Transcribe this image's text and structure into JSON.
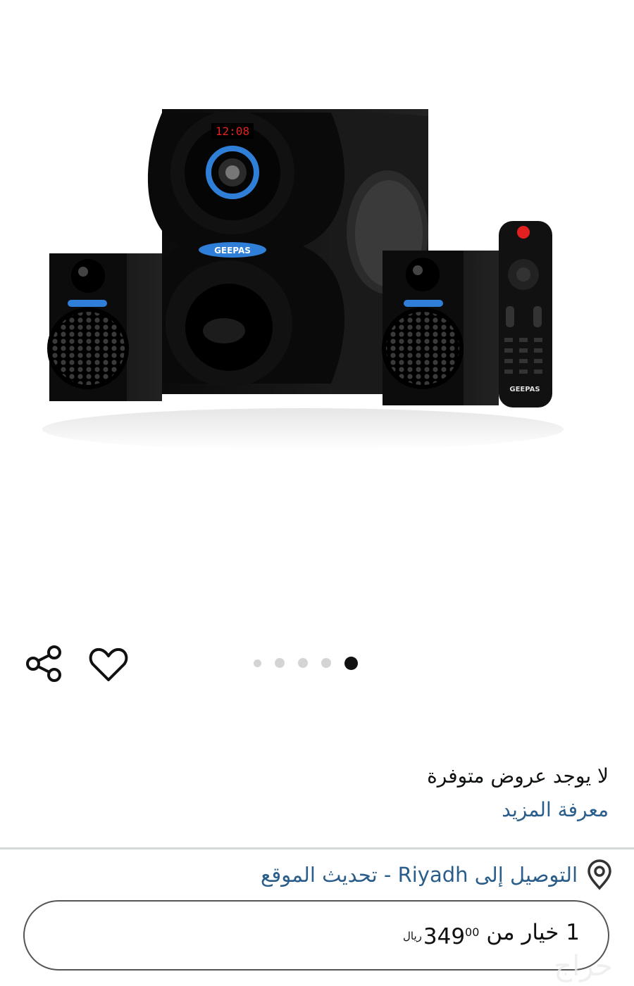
{
  "gallery": {
    "brand_label": "GEEPAS",
    "display_time": "12:08",
    "dots_total": 5,
    "dots_active_index": 4
  },
  "icons": {
    "share": "share-icon",
    "favorite": "heart-icon",
    "location": "location-pin-icon"
  },
  "offers": {
    "no_offers": "لا يوجد عروض متوفرة",
    "learn_more": "معرفة المزيد"
  },
  "delivery": {
    "text": "التوصيل إلى Riyadh - تحديث الموقع"
  },
  "options": {
    "label": "1 خيار من",
    "price_whole": "349",
    "price_fraction": "00",
    "currency": "ريال"
  },
  "watermark": "حراج",
  "colors": {
    "link": "#2a5d8a",
    "accent_blue": "#2f7fd8",
    "led_red": "#e32020"
  }
}
